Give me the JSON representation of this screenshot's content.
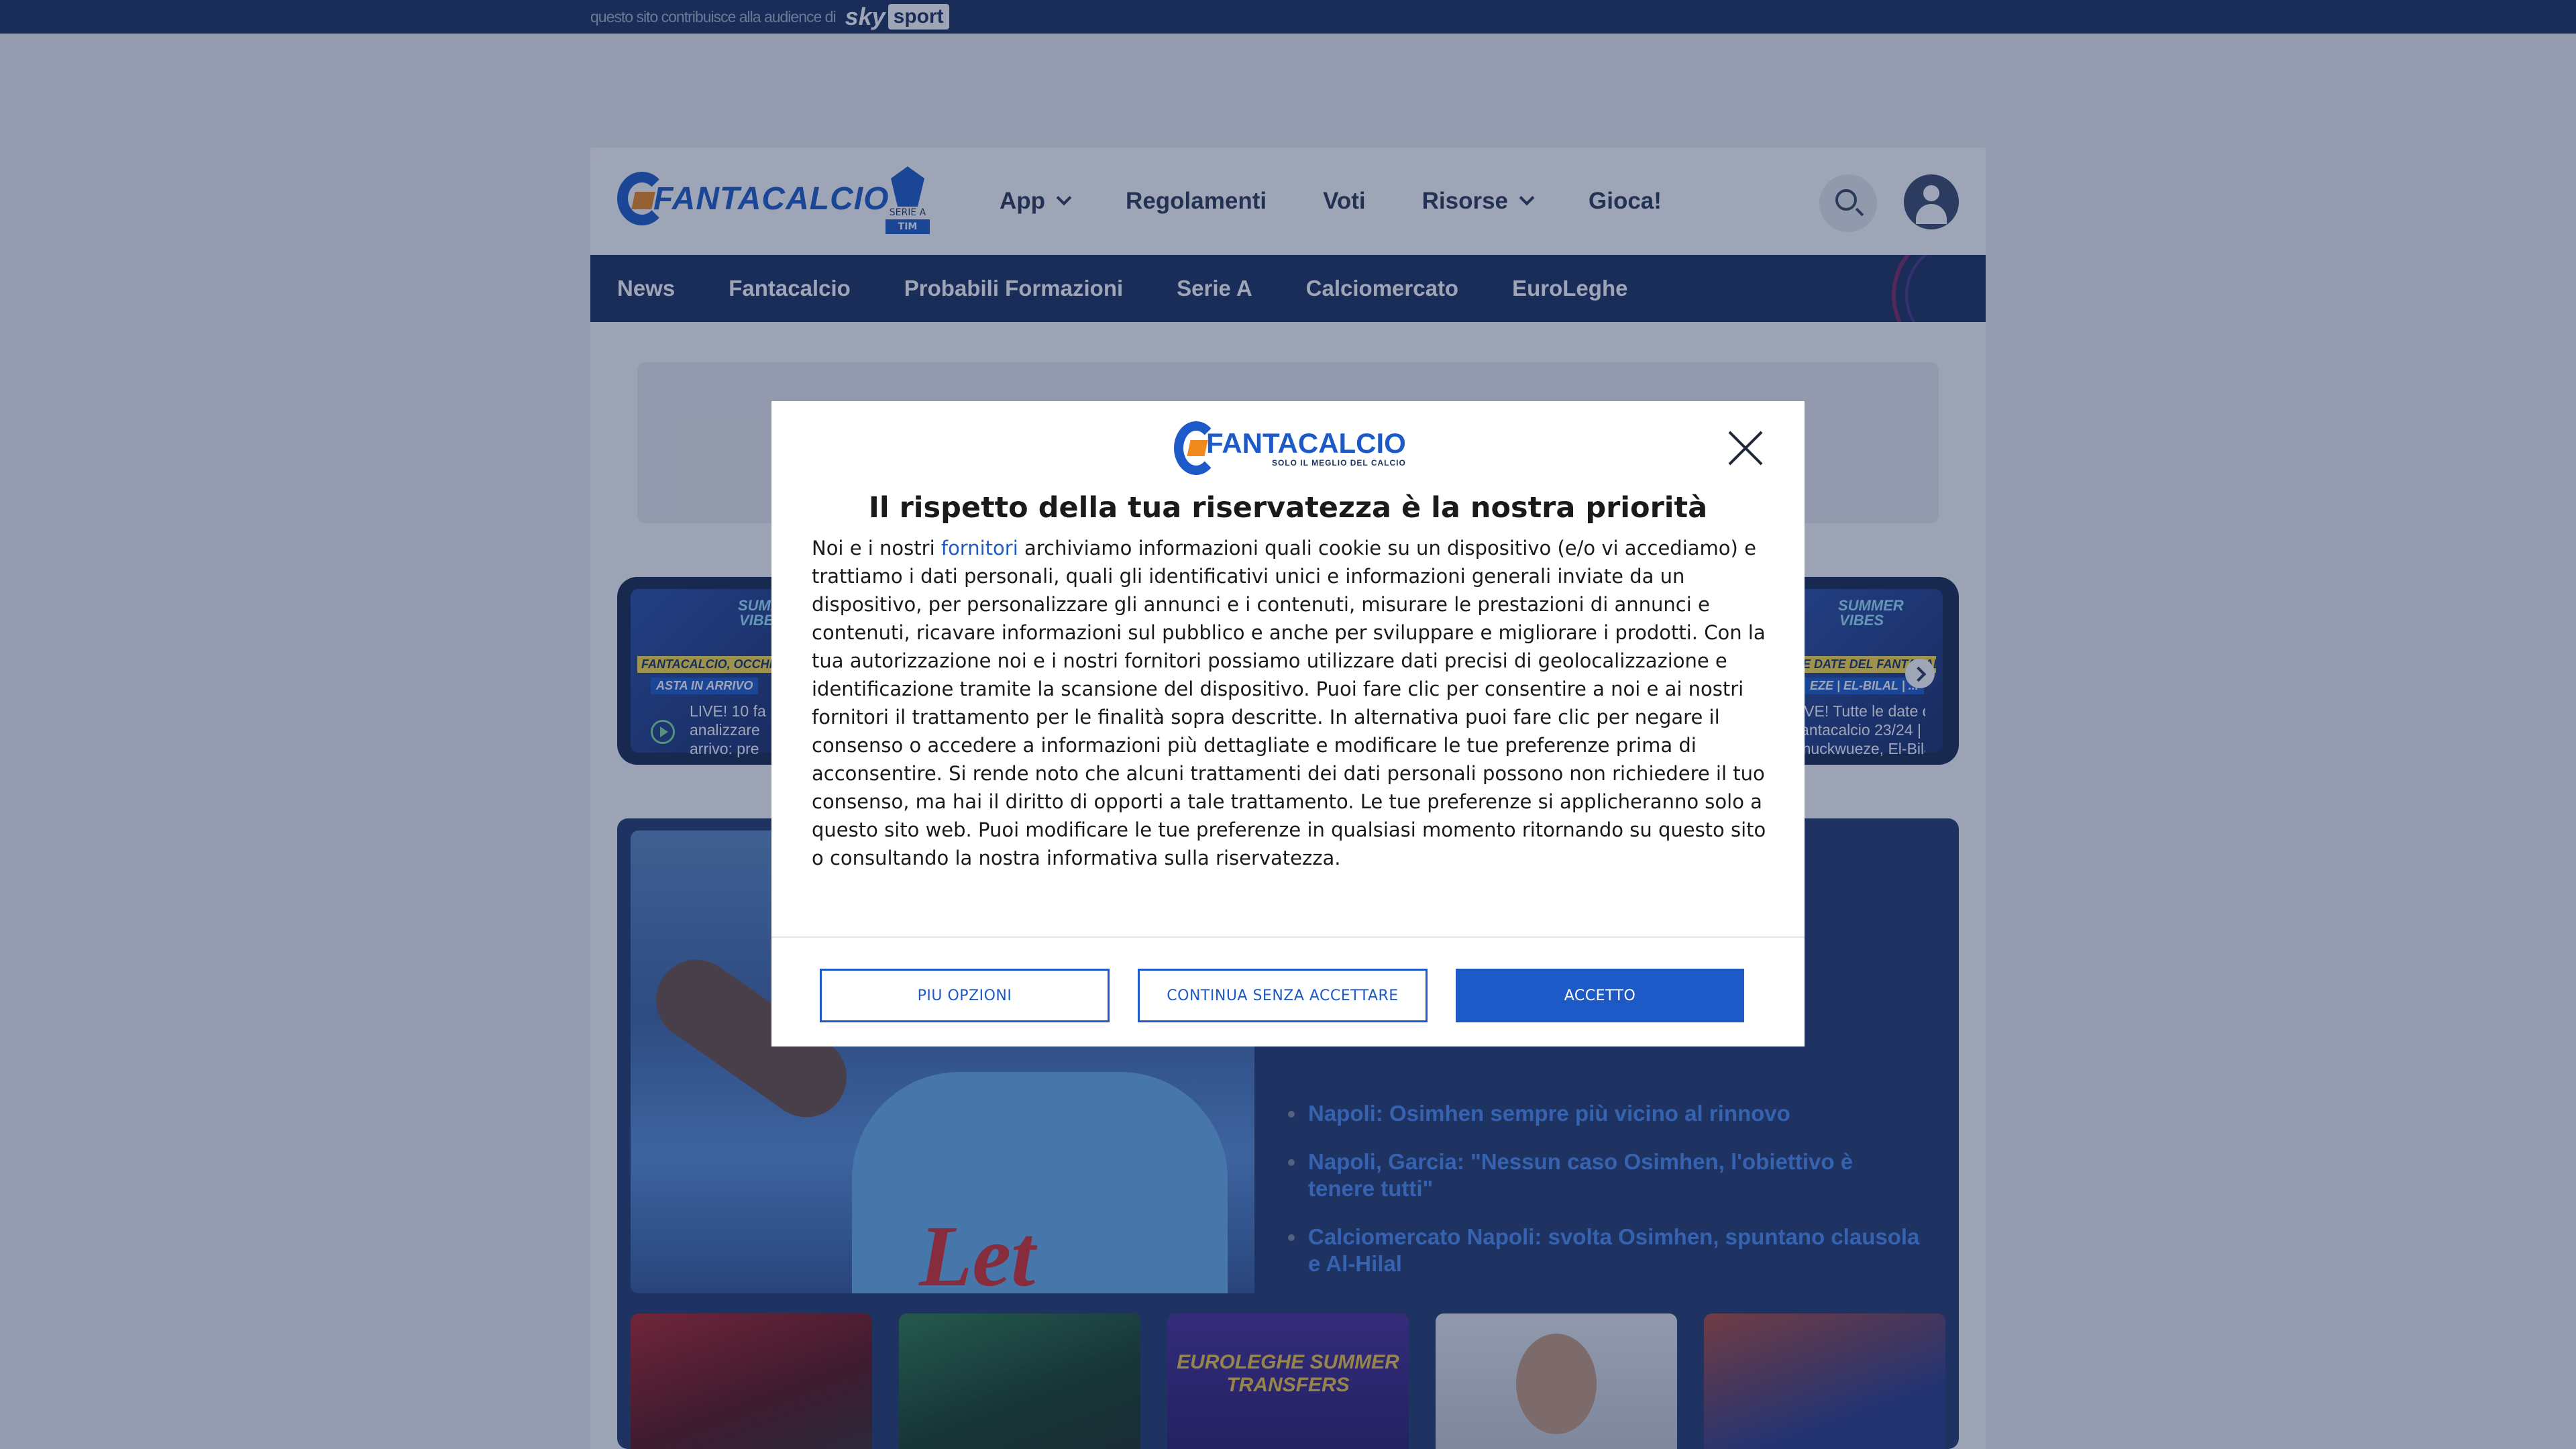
{
  "topstrip": {
    "note": "questo sito contribuisce alla audience di",
    "brand_sky": "sky",
    "brand_sport": "sport"
  },
  "header": {
    "logo": "FANTACALCIO",
    "league_badge": {
      "line1": "SERIE A",
      "line2": "TIM"
    },
    "nav": [
      {
        "label": "App",
        "has_dropdown": true
      },
      {
        "label": "Regolamenti",
        "has_dropdown": false
      },
      {
        "label": "Voti",
        "has_dropdown": false
      },
      {
        "label": "Risorse",
        "has_dropdown": true
      },
      {
        "label": "Gioca!",
        "has_dropdown": false
      }
    ],
    "icons": [
      "search-icon",
      "user-icon"
    ]
  },
  "subnav": [
    "News",
    "Fantacalcio",
    "Probabili Formazioni",
    "Serie A",
    "Calciomercato",
    "EuroLeghe"
  ],
  "carousel": [
    {
      "brand": "SUMMER VIBES",
      "headline": "FANTACALCIO, OCCHIO",
      "headline2": "ASTA IN ARRIVO",
      "caption_1": "LIVE! 10 fa",
      "caption_2": "analizzare",
      "caption_3": "arrivo: pre"
    },
    {
      "brand": "SUMMER VIBES",
      "headline": "LE DATE DEL FANTACALCIO 2",
      "headline2": "EZE | EL-BILAL | ...",
      "caption_1": "LIVE! Tutte le date de",
      "caption_2": "Fantacalcio 23/24 |",
      "caption_3": "Chuckwueze, El-Bila"
    }
  ],
  "featured": {
    "photo_text": "Let",
    "related": [
      "Napoli: Osimhen sempre più vicino al rinnovo",
      "Napoli, Garcia: \"Nessun caso Osimhen, l'obiettivo è tenere tutti\"",
      "Calciomercato Napoli: svolta Osimhen, spuntano clausola e Al-Hilal"
    ],
    "thumb_euroleghe": "EUROLEGHE SUMMER TRANSFERS"
  },
  "consent": {
    "logo": "FANTACALCIO",
    "logo_tagline": "SOLO IL MEGLIO DEL CALCIO",
    "title": "Il rispetto della tua riservatezza è la nostra priorità",
    "body_before_link": "Noi e i nostri ",
    "body_link": "fornitori",
    "body_after_link": " archiviamo informazioni quali cookie su un dispositivo (e/o vi accediamo) e trattiamo i dati personali, quali gli identificativi unici e informazioni generali inviate da un dispositivo, per personalizzare gli annunci e i contenuti, misurare le prestazioni di annunci e contenuti, ricavare informazioni sul pubblico e anche per sviluppare e migliorare i prodotti. Con la tua autorizzazione noi e i nostri fornitori possiamo utilizzare dati precisi di geolocalizzazione e identificazione tramite la scansione del dispositivo. Puoi fare clic per consentire a noi e ai nostri fornitori il trattamento per le finalità sopra descritte. In alternativa puoi fare clic per negare il consenso o accedere a informazioni più dettagliate e modificare le tue preferenze prima di acconsentire. Si rende noto che alcuni trattamenti dei dati personali possono non richiedere il tuo consenso, ma hai il diritto di opporti a tale trattamento. Le tue preferenze si applicheranno solo a questo sito web. Puoi modificare le tue preferenze in qualsiasi momento ritornando su questo sito o consultando la nostra informativa sulla riservatezza.",
    "buttons": {
      "more": "PIU OPZIONI",
      "continue": "CONTINUA SENZA ACCETTARE",
      "accept": "ACCETTO"
    }
  },
  "colors": {
    "brand_blue": "#1e5ac7",
    "navy": "#1c315d",
    "accent_orange": "#f08a1c"
  }
}
